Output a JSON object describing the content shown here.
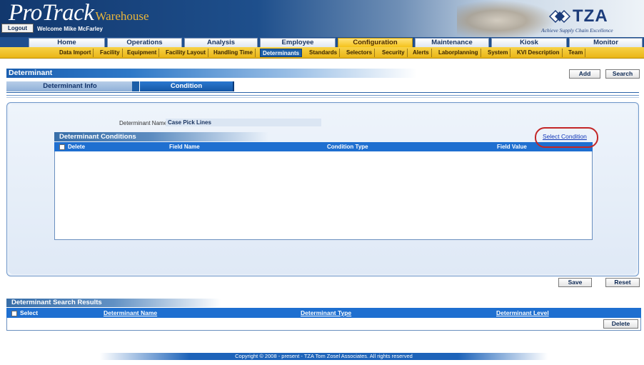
{
  "header": {
    "brand_main": "ProTrack",
    "brand_sub": "Warehouse",
    "logout_label": "Logout",
    "welcome": "Welcome Mike McFarley",
    "logo_text": "TZA",
    "tagline": "Achieve Supply Chain Excellence"
  },
  "main_nav": [
    {
      "label": "Home"
    },
    {
      "label": "Operations"
    },
    {
      "label": "Analysis"
    },
    {
      "label": "Employee"
    },
    {
      "label": "Configuration",
      "active": true
    },
    {
      "label": "Maintenance"
    },
    {
      "label": "Kiosk"
    },
    {
      "label": "Monitor"
    }
  ],
  "sub_nav": [
    {
      "label": "Data Import"
    },
    {
      "label": "Facility"
    },
    {
      "label": "Equipment"
    },
    {
      "label": "Facility Layout"
    },
    {
      "label": "Handling Time"
    },
    {
      "label": "Determinants",
      "active": true
    },
    {
      "label": "Standards"
    },
    {
      "label": "Selectors"
    },
    {
      "label": "Security"
    },
    {
      "label": "Alerts"
    },
    {
      "label": "Laborplanning"
    },
    {
      "label": "System"
    },
    {
      "label": "KVI Description"
    },
    {
      "label": "Team"
    }
  ],
  "page": {
    "title": "Determinant",
    "add_label": "Add",
    "search_label": "Search"
  },
  "tabs": {
    "info_label": "Determinant Info",
    "condition_label": "Condition"
  },
  "form": {
    "name_label": "Determinant Name",
    "name_value": "Case Pick Lines"
  },
  "conditions": {
    "title": "Determinant Conditions",
    "select_condition_label": "Select Condition",
    "columns": {
      "delete": "Delete",
      "field_name": "Field Name",
      "condition_type": "Condition Type",
      "field_value": "Field Value"
    },
    "rows": []
  },
  "actions": {
    "save_label": "Save",
    "reset_label": "Reset"
  },
  "results": {
    "title": "Determinant Search Results",
    "columns": {
      "select": "Select",
      "name": "Determinant Name",
      "type": "Determinant Type",
      "level": "Determinant Level"
    },
    "delete_label": "Delete",
    "rows": []
  },
  "footer": {
    "copyright": "Copyright © 2008 - present - TZA Tom Zosel Associates. All rights reserved"
  },
  "colors": {
    "header_blue": "#1e4f8c",
    "nav_yellow": "#f5c21a",
    "accent_blue": "#1e6fd0",
    "highlight_red": "#c32626"
  }
}
